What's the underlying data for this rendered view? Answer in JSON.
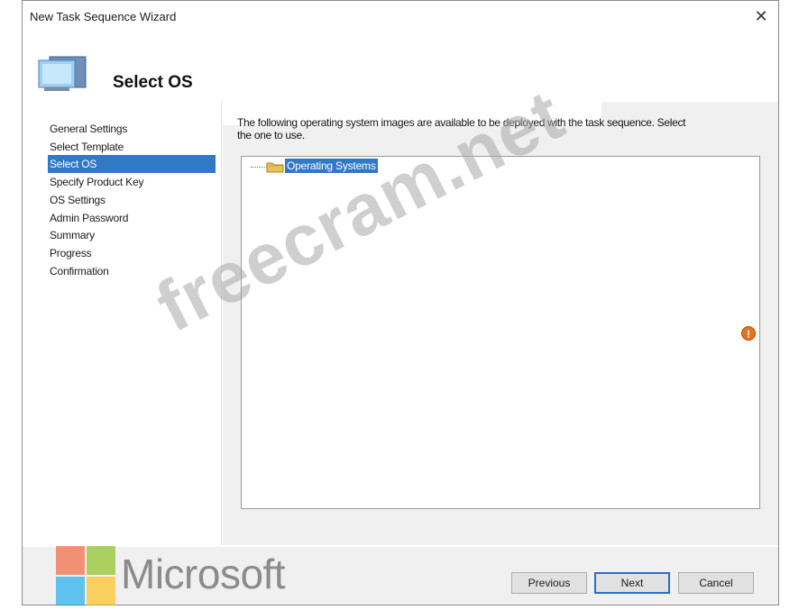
{
  "window": {
    "title": "New Task Sequence Wizard",
    "close_glyph": "✕"
  },
  "header": {
    "page_title": "Select OS",
    "icon": "computer-icon"
  },
  "nav": {
    "items": [
      {
        "label": "General Settings",
        "selected": false
      },
      {
        "label": "Select Template",
        "selected": false
      },
      {
        "label": "Select OS",
        "selected": true
      },
      {
        "label": "Specify Product Key",
        "selected": false
      },
      {
        "label": "OS Settings",
        "selected": false
      },
      {
        "label": "Admin Password",
        "selected": false
      },
      {
        "label": "Summary",
        "selected": false
      },
      {
        "label": "Progress",
        "selected": false
      },
      {
        "label": "Confirmation",
        "selected": false
      }
    ]
  },
  "main": {
    "description_line1": "The following operating system images are available to be deployed with the task sequence. Select",
    "description_line2": "the one to use.",
    "tree": {
      "root_label": "Operating Systems",
      "root_icon": "folder-icon",
      "selected": true
    },
    "error_glyph": "!"
  },
  "footer": {
    "previous_label": "Previous",
    "next_label": "Next",
    "cancel_label": "Cancel"
  },
  "overlays": {
    "watermark_text": "freecram.net",
    "logo_text": "Microsoft",
    "logo_colors": [
      "#f25022",
      "#7fba00",
      "#00a4ef",
      "#ffb900"
    ]
  },
  "colors": {
    "selection": "#3178c6",
    "dialog_bg": "#f0f0f0"
  }
}
